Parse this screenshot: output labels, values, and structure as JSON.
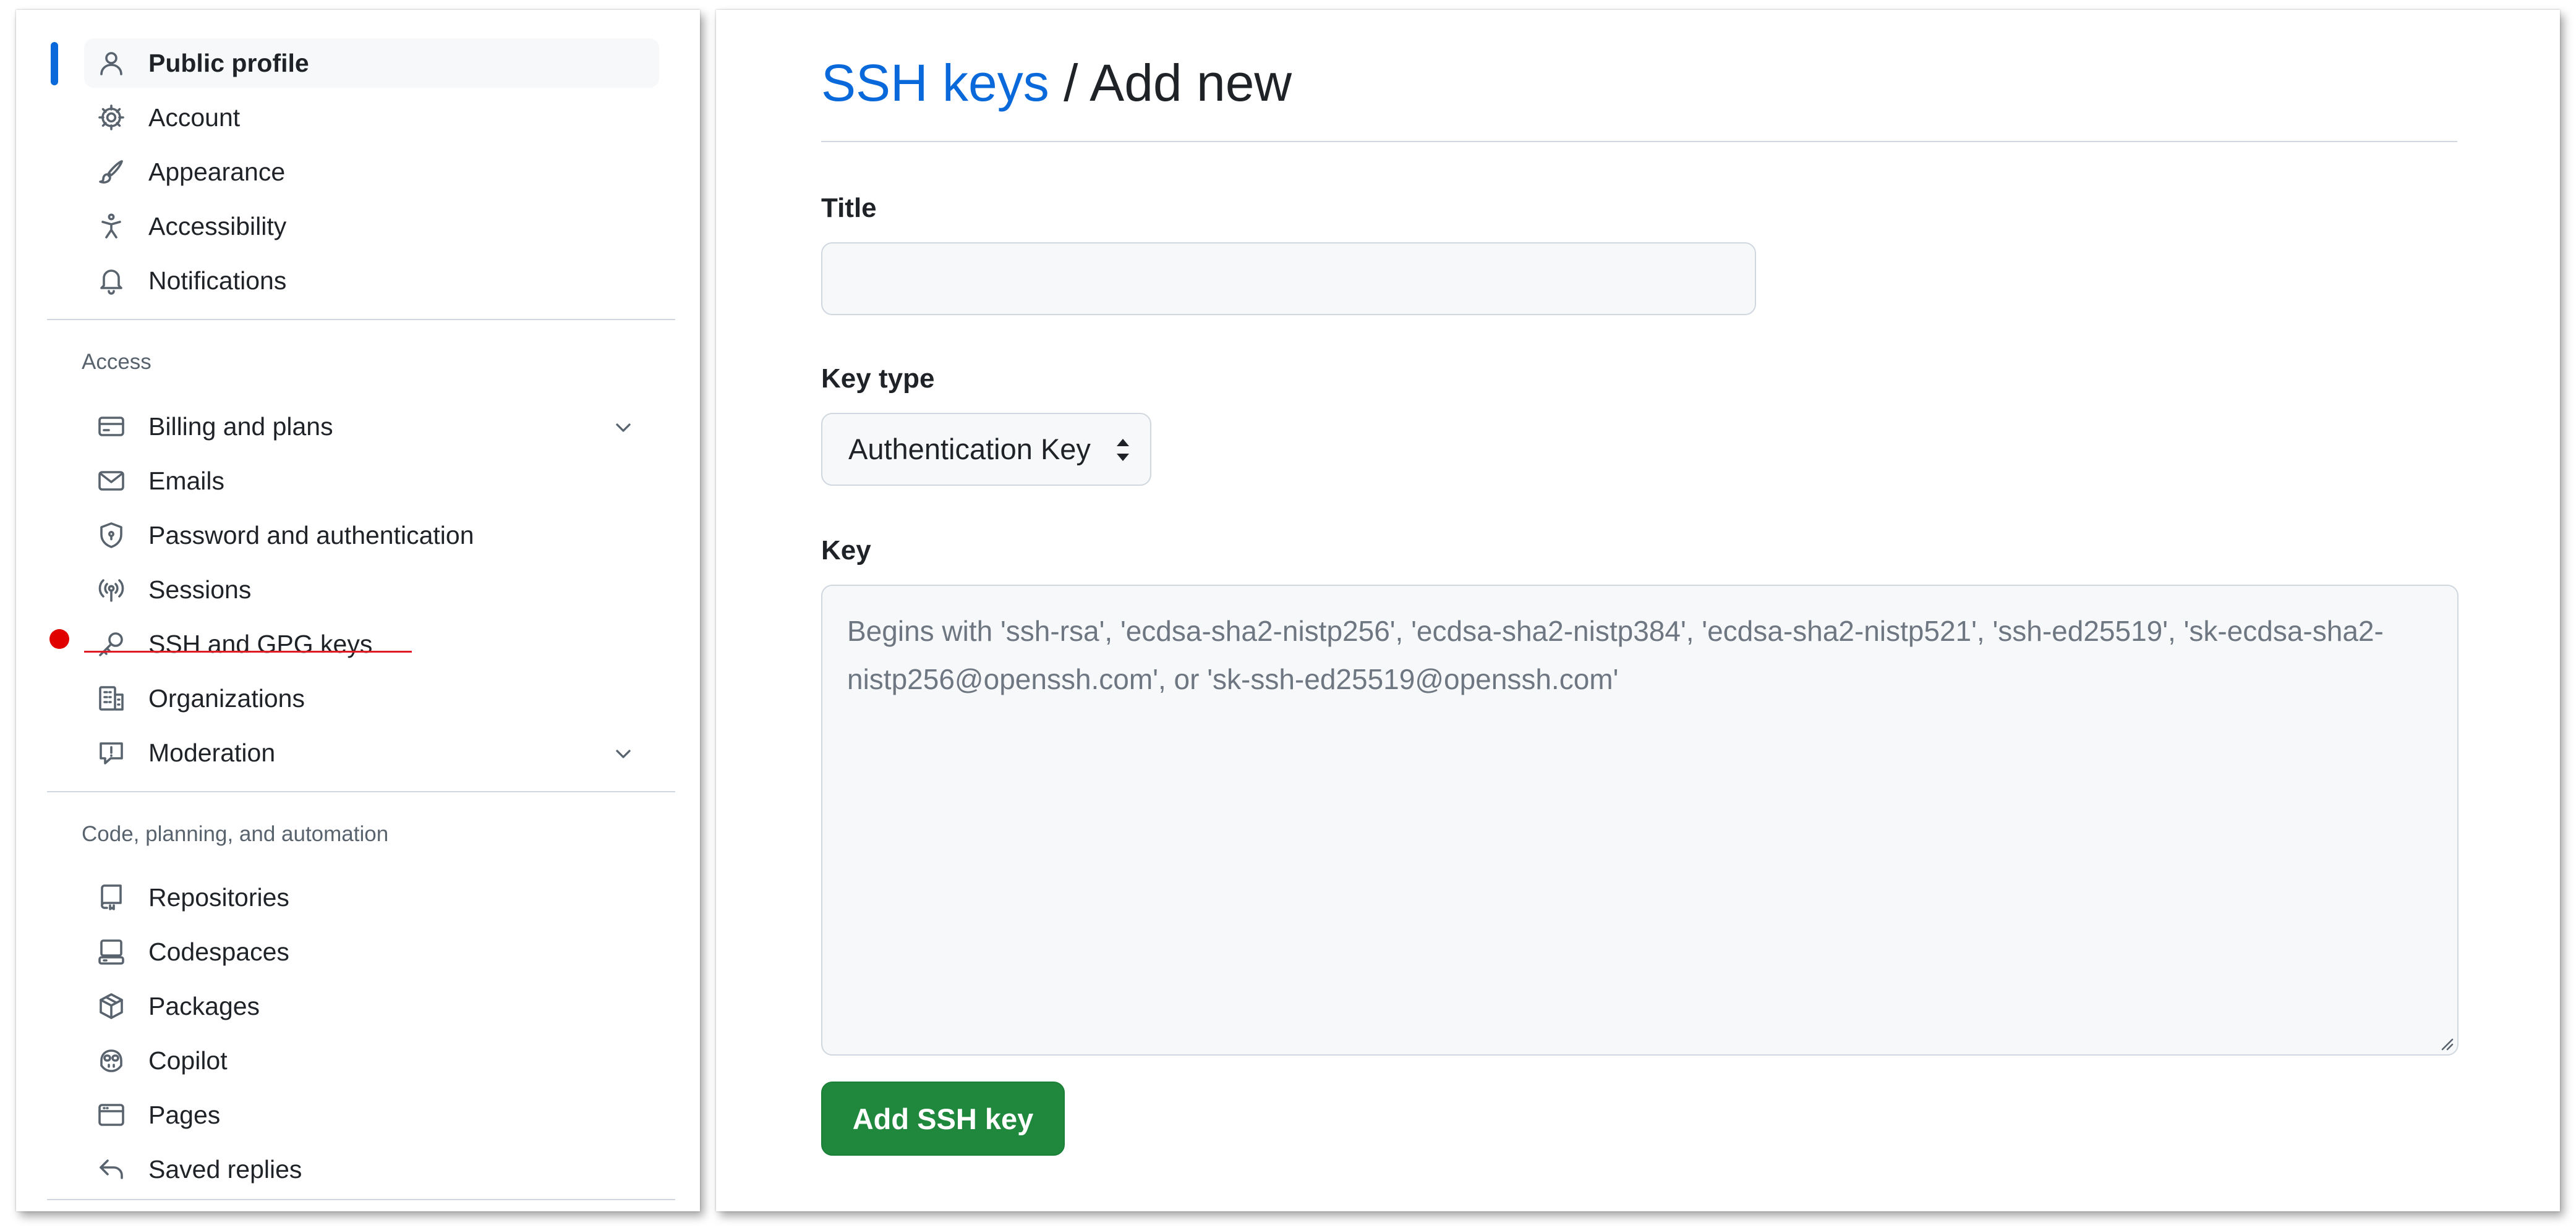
{
  "sidebar": {
    "items": [
      {
        "label": "Public profile",
        "icon": "person-icon"
      },
      {
        "label": "Account",
        "icon": "gear-icon"
      },
      {
        "label": "Appearance",
        "icon": "paintbrush-icon"
      },
      {
        "label": "Accessibility",
        "icon": "accessibility-icon"
      },
      {
        "label": "Notifications",
        "icon": "bell-icon"
      }
    ],
    "access": {
      "heading": "Access",
      "items": [
        {
          "label": "Billing and plans",
          "icon": "credit-card-icon"
        },
        {
          "label": "Emails",
          "icon": "mail-icon"
        },
        {
          "label": "Password and authentication",
          "icon": "shield-lock-icon"
        },
        {
          "label": "Sessions",
          "icon": "broadcast-icon"
        },
        {
          "label": "SSH and GPG keys",
          "icon": "key-icon"
        },
        {
          "label": "Organizations",
          "icon": "organization-icon"
        },
        {
          "label": "Moderation",
          "icon": "report-icon"
        }
      ]
    },
    "code": {
      "heading": "Code, planning, and automation",
      "items": [
        {
          "label": "Repositories",
          "icon": "repo-icon"
        },
        {
          "label": "Codespaces",
          "icon": "codespaces-icon"
        },
        {
          "label": "Packages",
          "icon": "package-icon"
        },
        {
          "label": "Copilot",
          "icon": "copilot-icon"
        },
        {
          "label": "Pages",
          "icon": "browser-icon"
        },
        {
          "label": "Saved replies",
          "icon": "reply-icon"
        }
      ]
    }
  },
  "main": {
    "breadcrumb": {
      "link": "SSH keys",
      "separator": "/",
      "current": "Add new"
    },
    "title_label": "Title",
    "title_value": "",
    "key_type_label": "Key type",
    "key_type_value": "Authentication Key",
    "key_label": "Key",
    "key_placeholder": "Begins with 'ssh-rsa', 'ecdsa-sha2-nistp256', 'ecdsa-sha2-nistp384', 'ecdsa-sha2-nistp521', 'ssh-ed25519', 'sk-ecdsa-sha2-nistp256@openssh.com', or 'sk-ssh-ed25519@openssh.com'",
    "submit_label": "Add SSH key"
  },
  "colors": {
    "link": "#0969da",
    "primary_button": "#1f883d",
    "active_indicator": "#0969da",
    "annotation_red": "#e01b24"
  }
}
